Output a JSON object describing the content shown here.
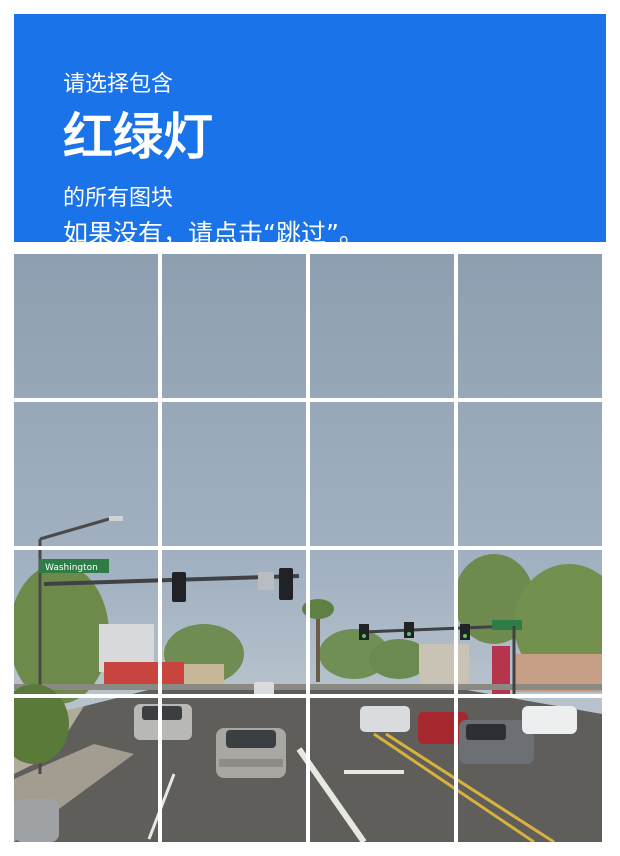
{
  "challenge": {
    "prompt_line1": "请选择包含",
    "object_label": "红绿灯",
    "prompt_line2": "的所有图块",
    "skip_hint": "如果没有，请点击“跳过”。"
  },
  "scene": {
    "street_sign_text": "Washington"
  },
  "grid": {
    "rows": 4,
    "cols": 4,
    "tiles": [
      {
        "id": "tile-1-1"
      },
      {
        "id": "tile-1-2"
      },
      {
        "id": "tile-1-3"
      },
      {
        "id": "tile-1-4"
      },
      {
        "id": "tile-2-1"
      },
      {
        "id": "tile-2-2"
      },
      {
        "id": "tile-2-3"
      },
      {
        "id": "tile-2-4"
      },
      {
        "id": "tile-3-1"
      },
      {
        "id": "tile-3-2"
      },
      {
        "id": "tile-3-3"
      },
      {
        "id": "tile-3-4"
      },
      {
        "id": "tile-4-1"
      },
      {
        "id": "tile-4-2"
      },
      {
        "id": "tile-4-3"
      },
      {
        "id": "tile-4-4"
      }
    ]
  },
  "colors": {
    "header_bg": "#1a73e8",
    "header_text": "#ffffff",
    "grid_gap": "#ffffff"
  }
}
